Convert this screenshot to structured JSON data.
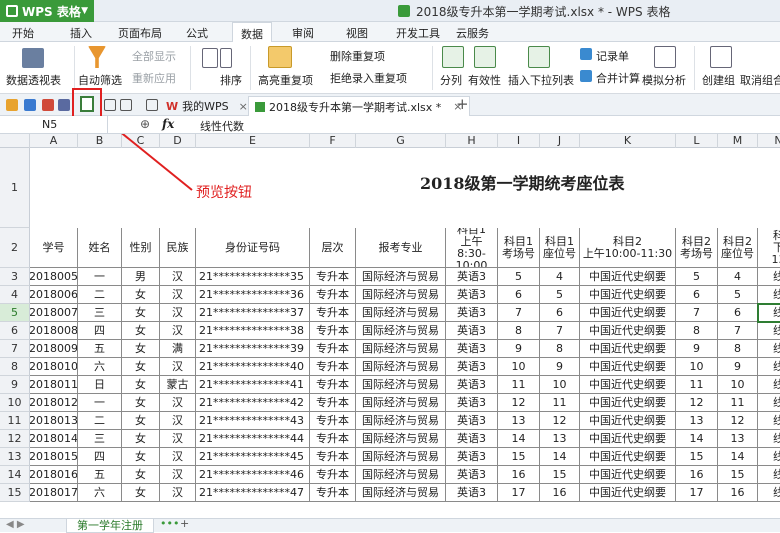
{
  "app": {
    "name": "WPS 表格",
    "window_title": "2018级专升本第一学期考试.xlsx * - WPS 表格"
  },
  "ribbon_tabs": [
    "开始",
    "插入",
    "页面布局",
    "公式",
    "数据",
    "审阅",
    "视图",
    "开发工具",
    "云服务"
  ],
  "active_tab": "数据",
  "ribbon": {
    "pivot": "数据透视表",
    "autofilter": "自动筛选",
    "show_all": "全部显示",
    "reapply": "重新应用",
    "sort": "排序",
    "highlight_dup": "高亮重复项",
    "remove_dup": "删除重复项",
    "reject_dup": "拒绝录入重复项",
    "split": "分列",
    "validity": "有效性",
    "dropdown": "插入下拉列表",
    "record": "记录单",
    "merge_calc": "合并计算",
    "simulate": "模拟分析",
    "create_group": "创建组",
    "ungroup": "取消组合"
  },
  "doc_tabs": [
    "我的WPS",
    "2018级专升本第一学期考试.xlsx *"
  ],
  "formula_bar": {
    "cell_ref": "N5",
    "fx": "fx",
    "content": "线性代数"
  },
  "columns": [
    "A",
    "B",
    "C",
    "D",
    "E",
    "F",
    "G",
    "H",
    "I",
    "J",
    "K",
    "L",
    "M",
    "N"
  ],
  "sheet_title": "2018级第一学期统考座位表",
  "annotation": "预览按钮",
  "headers": [
    "学号",
    "姓名",
    "性别",
    "民族",
    "身份证号码",
    "层次",
    "报考专业",
    "科目1\n上午\n8:30-\n10:00",
    "科目1\n考场号",
    "科目1\n座位号",
    "科目2\n上午10:00-11:30",
    "科目2\n考场号",
    "科目2\n座位号",
    "科\n下\n13"
  ],
  "row_numbers": [
    "1",
    "2",
    "3",
    "4",
    "5",
    "6",
    "7",
    "8",
    "9",
    "10",
    "11",
    "12",
    "13",
    "14",
    "15"
  ],
  "rows": [
    [
      "2018005",
      "一",
      "男",
      "汉",
      "21**************35",
      "专升本",
      "国际经济与贸易",
      "英语3",
      "5",
      "4",
      "中国近代史纲要",
      "5",
      "4",
      "线"
    ],
    [
      "2018006",
      "二",
      "女",
      "汉",
      "21**************36",
      "专升本",
      "国际经济与贸易",
      "英语3",
      "6",
      "5",
      "中国近代史纲要",
      "6",
      "5",
      "线"
    ],
    [
      "2018007",
      "三",
      "女",
      "汉",
      "21**************37",
      "专升本",
      "国际经济与贸易",
      "英语3",
      "7",
      "6",
      "中国近代史纲要",
      "7",
      "6",
      "线"
    ],
    [
      "2018008",
      "四",
      "女",
      "汉",
      "21**************38",
      "专升本",
      "国际经济与贸易",
      "英语3",
      "8",
      "7",
      "中国近代史纲要",
      "8",
      "7",
      "线"
    ],
    [
      "2018009",
      "五",
      "女",
      "满",
      "21**************39",
      "专升本",
      "国际经济与贸易",
      "英语3",
      "9",
      "8",
      "中国近代史纲要",
      "9",
      "8",
      "线"
    ],
    [
      "2018010",
      "六",
      "女",
      "汉",
      "21**************40",
      "专升本",
      "国际经济与贸易",
      "英语3",
      "10",
      "9",
      "中国近代史纲要",
      "10",
      "9",
      "线"
    ],
    [
      "2018011",
      "日",
      "女",
      "蒙古",
      "21**************41",
      "专升本",
      "国际经济与贸易",
      "英语3",
      "11",
      "10",
      "中国近代史纲要",
      "11",
      "10",
      "线"
    ],
    [
      "2018012",
      "一",
      "女",
      "汉",
      "21**************42",
      "专升本",
      "国际经济与贸易",
      "英语3",
      "12",
      "11",
      "中国近代史纲要",
      "12",
      "11",
      "线"
    ],
    [
      "2018013",
      "二",
      "女",
      "汉",
      "21**************43",
      "专升本",
      "国际经济与贸易",
      "英语3",
      "13",
      "12",
      "中国近代史纲要",
      "13",
      "12",
      "线"
    ],
    [
      "2018014",
      "三",
      "女",
      "汉",
      "21**************44",
      "专升本",
      "国际经济与贸易",
      "英语3",
      "14",
      "13",
      "中国近代史纲要",
      "14",
      "13",
      "线"
    ],
    [
      "2018015",
      "四",
      "女",
      "汉",
      "21**************45",
      "专升本",
      "国际经济与贸易",
      "英语3",
      "15",
      "14",
      "中国近代史纲要",
      "15",
      "14",
      "线"
    ],
    [
      "2018016",
      "五",
      "女",
      "汉",
      "21**************46",
      "专升本",
      "国际经济与贸易",
      "英语3",
      "16",
      "15",
      "中国近代史纲要",
      "16",
      "15",
      "线"
    ],
    [
      "2018017",
      "六",
      "女",
      "汉",
      "21**************47",
      "专升本",
      "国际经济与贸易",
      "英语3",
      "17",
      "16",
      "中国近代史纲要",
      "17",
      "16",
      "线"
    ]
  ],
  "sheet_tab": "第一学年注册",
  "colors": {
    "accent": "#3a9a3a",
    "annotation": "#e02020",
    "selection": "#2e7d32"
  },
  "icons": [
    "wps-logo",
    "pivot-icon",
    "filter-icon",
    "sort-icon",
    "highlight-icon",
    "split-icon",
    "validity-icon",
    "dropdown-icon",
    "record-icon",
    "merge-icon",
    "simulate-icon",
    "group-icon",
    "open-icon",
    "save-icon",
    "pdf-icon",
    "print-icon",
    "print-preview-icon",
    "undo-icon",
    "redo-icon",
    "wps-icon",
    "spreadsheet-icon",
    "close-icon",
    "add-tab-icon",
    "zoom-icon",
    "fx-icon"
  ]
}
